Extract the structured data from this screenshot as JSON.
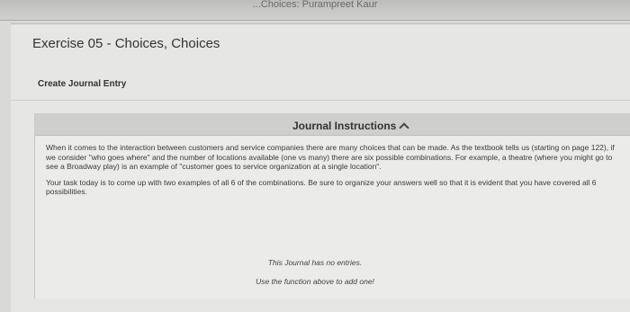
{
  "topbar": {
    "text": "...Choices: Purampreet Kaur"
  },
  "exercise": {
    "title": "Exercise 05 - Choices, Choices"
  },
  "create_entry": {
    "label": "Create Journal Entry"
  },
  "journal": {
    "header_title": "Journal Instructions",
    "paragraph1": "When it comes to the interaction between customers and service companies there are many choices that can be made. As the textbook tells us (starting on page 122), if we consider \"who goes where\" and the number of locations available (one vs many) there are six possible combinations. For example, a theatre (where you might go to see a Broadway play) is an example of \"customer goes to service organization at a single location\".",
    "paragraph2": "Your task today is to come up with two examples of all 6 of the combinations. Be sure to organize your answers well so that it is evident that you have covered all 6 possibilities.",
    "empty_message": "This Journal has no entries.",
    "empty_hint": "Use the function above to add one!"
  },
  "icons": {
    "collapse": "chevron-up-icon"
  }
}
